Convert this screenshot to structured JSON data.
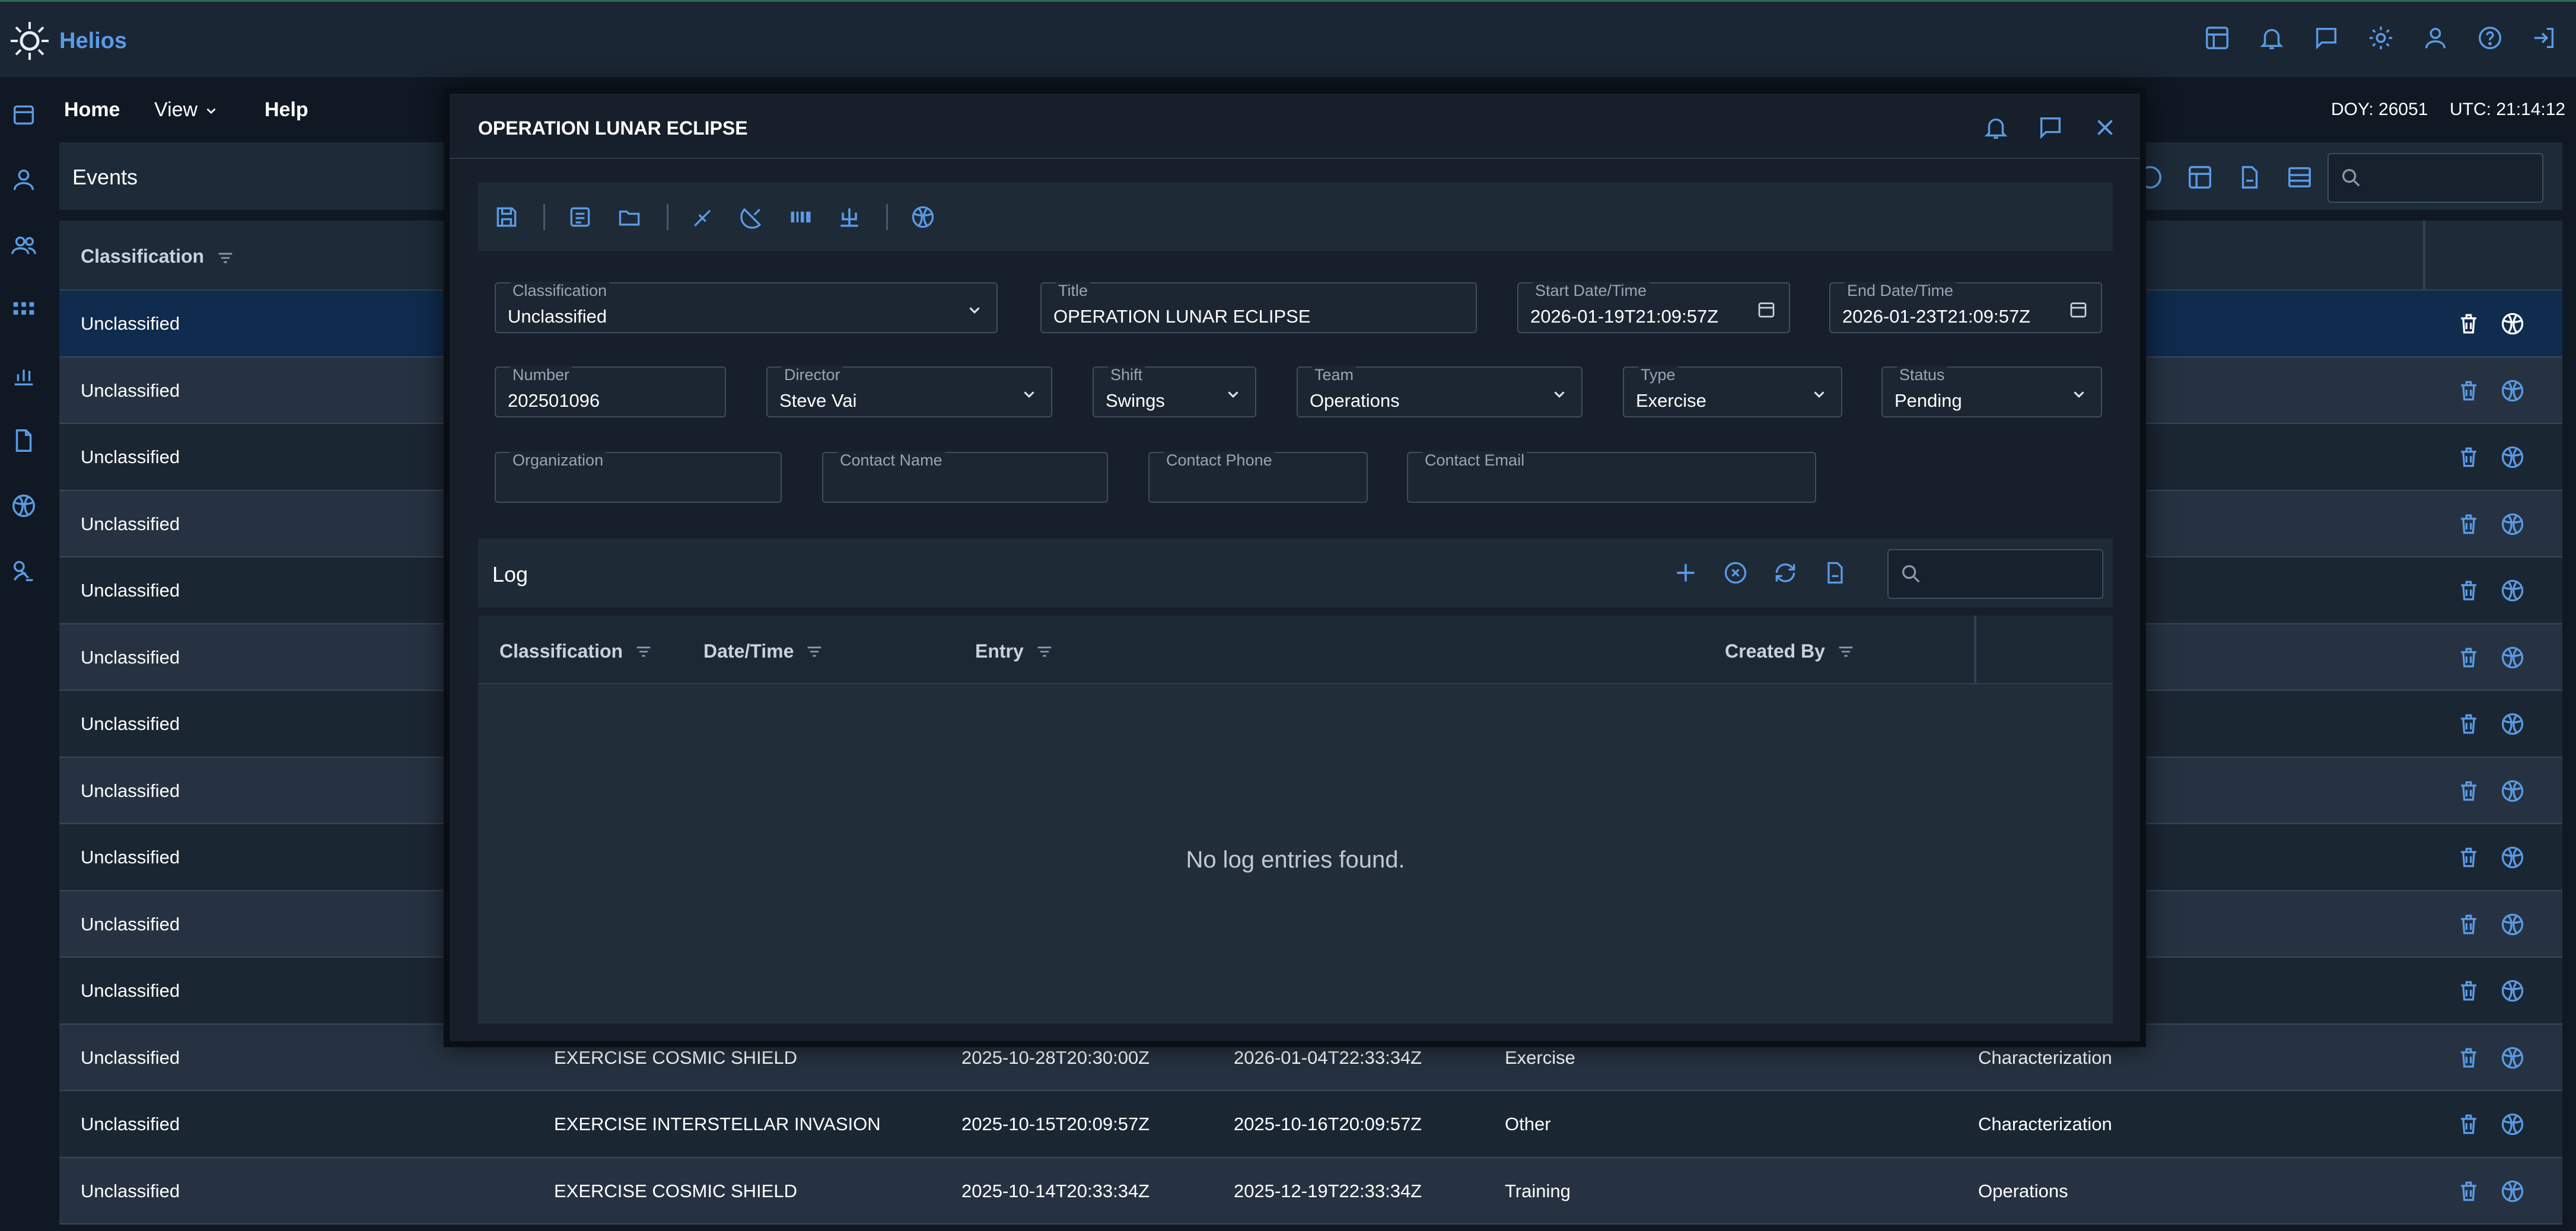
{
  "app": {
    "name": "Helios"
  },
  "menu": {
    "home": "Home",
    "view": "View",
    "help": "Help"
  },
  "status": {
    "doy": "DOY: 26051",
    "utc": "UTC: 21:14:12"
  },
  "events": {
    "title": "Events",
    "column_classification": "Classification",
    "rows": [
      {
        "classification": "Unclassified",
        "title": "",
        "start": "",
        "end": "",
        "type": "",
        "team": ""
      },
      {
        "classification": "Unclassified",
        "title": "",
        "start": "",
        "end": "",
        "type": "",
        "team": ""
      },
      {
        "classification": "Unclassified",
        "title": "",
        "start": "",
        "end": "",
        "type": "",
        "team": ""
      },
      {
        "classification": "Unclassified",
        "title": "",
        "start": "",
        "end": "",
        "type": "",
        "team": ""
      },
      {
        "classification": "Unclassified",
        "title": "",
        "start": "",
        "end": "",
        "type": "",
        "team": ""
      },
      {
        "classification": "Unclassified",
        "title": "",
        "start": "",
        "end": "",
        "type": "",
        "team": ""
      },
      {
        "classification": "Unclassified",
        "title": "",
        "start": "",
        "end": "",
        "type": "",
        "team": ""
      },
      {
        "classification": "Unclassified",
        "title": "",
        "start": "",
        "end": "",
        "type": "",
        "team": ""
      },
      {
        "classification": "Unclassified",
        "title": "",
        "start": "",
        "end": "",
        "type": "",
        "team": ""
      },
      {
        "classification": "Unclassified",
        "title": "",
        "start": "",
        "end": "",
        "type": "",
        "team": ""
      },
      {
        "classification": "Unclassified",
        "title": "",
        "start": "",
        "end": "",
        "type": "",
        "team": ""
      },
      {
        "classification": "Unclassified",
        "title": "EXERCISE COSMIC SHIELD",
        "start": "2025-10-28T20:30:00Z",
        "end": "2026-01-04T22:33:34Z",
        "type": "Exercise",
        "team": "Characterization"
      },
      {
        "classification": "Unclassified",
        "title": "EXERCISE INTERSTELLAR INVASION",
        "start": "2025-10-15T20:09:57Z",
        "end": "2025-10-16T20:09:57Z",
        "type": "Other",
        "team": "Characterization"
      },
      {
        "classification": "Unclassified",
        "title": "EXERCISE COSMIC SHIELD",
        "start": "2025-10-14T20:33:34Z",
        "end": "2025-12-19T22:33:34Z",
        "type": "Training",
        "team": "Operations"
      }
    ]
  },
  "modal": {
    "title": "OPERATION LUNAR ECLIPSE",
    "fields": {
      "classification": {
        "label": "Classification",
        "value": "Unclassified"
      },
      "title": {
        "label": "Title",
        "value": "OPERATION LUNAR ECLIPSE"
      },
      "start": {
        "label": "Start Date/Time",
        "value": "2026-01-19T21:09:57Z"
      },
      "end": {
        "label": "End Date/Time",
        "value": "2026-01-23T21:09:57Z"
      },
      "number": {
        "label": "Number",
        "value": "202501096"
      },
      "director": {
        "label": "Director",
        "value": "Steve Vai"
      },
      "shift": {
        "label": "Shift",
        "value": "Swings"
      },
      "team": {
        "label": "Team",
        "value": "Operations"
      },
      "type": {
        "label": "Type",
        "value": "Exercise"
      },
      "status": {
        "label": "Status",
        "value": "Pending"
      },
      "organization": {
        "label": "Organization",
        "value": ""
      },
      "contact_name": {
        "label": "Contact Name",
        "value": ""
      },
      "contact_phone": {
        "label": "Contact Phone",
        "value": ""
      },
      "contact_email": {
        "label": "Contact Email",
        "value": ""
      }
    },
    "log": {
      "title": "Log",
      "columns": [
        "Classification",
        "Date/Time",
        "Entry",
        "Created By"
      ],
      "empty": "No log entries found.",
      "search_placeholder": ""
    }
  },
  "colors": {
    "accent": "#5a9be6",
    "background": "#0f1823",
    "selected_row": "#0f2b4d"
  },
  "icons": {
    "top": [
      "layout-icon",
      "bell-refresh-icon",
      "chat-icon",
      "gear-icon",
      "user-icon",
      "help-icon",
      "logout-icon"
    ],
    "rail": [
      "calendar-icon",
      "user-icon",
      "users-icon",
      "grid-icon",
      "bar-chart-icon",
      "document-icon",
      "globe-icon",
      "satellite-icon"
    ]
  }
}
